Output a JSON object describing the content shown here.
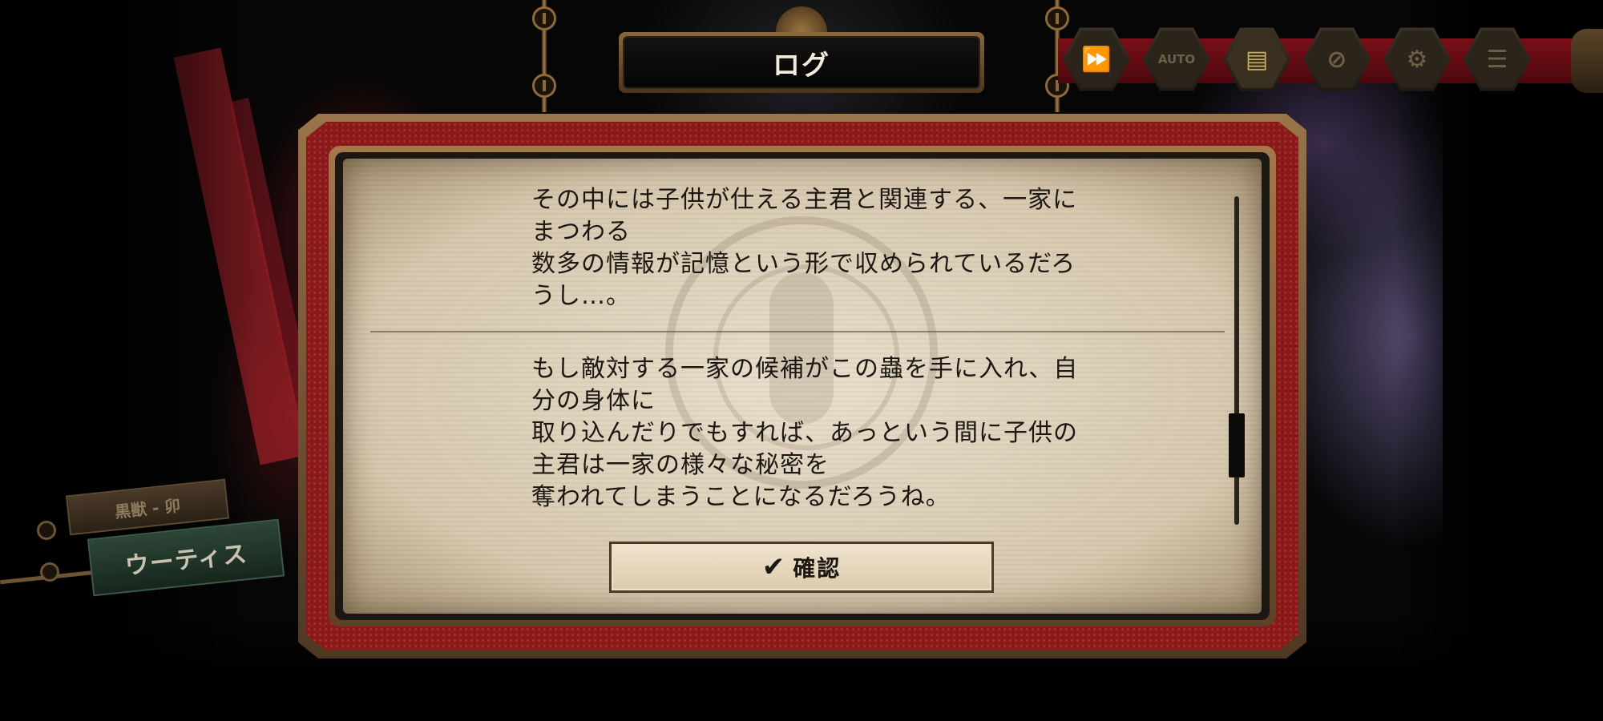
{
  "header": {
    "title": "ログ"
  },
  "toolbar": {
    "buttons": [
      {
        "name": "fast-forward",
        "glyph": "⏩",
        "active": false
      },
      {
        "name": "auto",
        "glyph": "AUTO",
        "active": false
      },
      {
        "name": "log",
        "glyph": "▤",
        "active": true
      },
      {
        "name": "hide-ui",
        "glyph": "⊘",
        "active": false
      },
      {
        "name": "settings",
        "glyph": "⚙",
        "active": false
      },
      {
        "name": "menu",
        "glyph": "☰",
        "active": false
      }
    ]
  },
  "log": {
    "entries": [
      {
        "lines": [
          "その中には子供が仕える主君と関連する、一家に",
          "まつわる",
          "数多の情報が記憶という形で収められているだろ",
          "うし…。"
        ]
      },
      {
        "lines": [
          "もし敵対する一家の候補がこの蟲を手に入れ、自",
          "分の身体に",
          "取り込んだりでもすれば、あっという間に子供の",
          "主君は一家の様々な秘密を",
          "奪われてしまうことになるだろうね。"
        ]
      }
    ],
    "scroll_position": 0.82,
    "confirm_button": {
      "icon": "✔",
      "label": "確認"
    }
  },
  "speaker": {
    "subtitle": "黒獣 - 卯",
    "name": "ウーティス"
  }
}
